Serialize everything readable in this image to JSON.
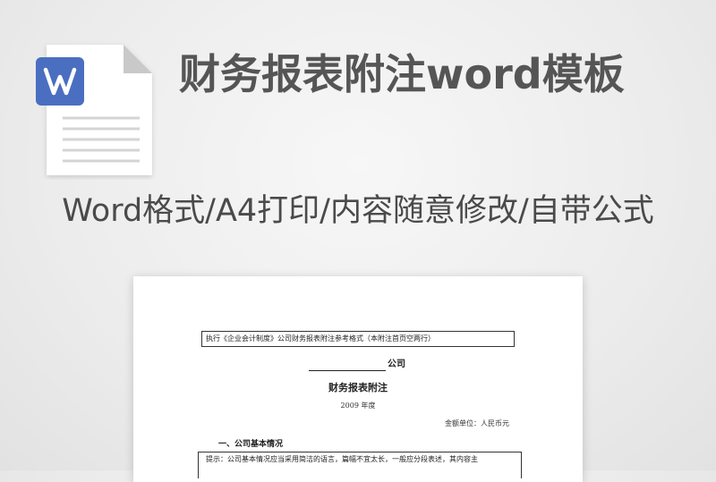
{
  "header": {
    "title": "财务报表附注word模板",
    "subtitle": "Word格式/A4打印/内容随意修改/自带公式"
  },
  "icon": {
    "name": "word-file-icon",
    "accent": "#4a6fc0"
  },
  "document": {
    "note": "执行《企业会计制度》公司财务报表附注参考格式（本附注首页空两行）",
    "company_suffix": "公司",
    "heading": "财务报表附注",
    "year": "2009 年度",
    "unit": "金额单位：人民币元",
    "section": "一、公司基本情况",
    "hint": "提示：公司基本情况应当采用简洁的语言，篇幅不宜太长，一般应分段表述，其内容主"
  }
}
